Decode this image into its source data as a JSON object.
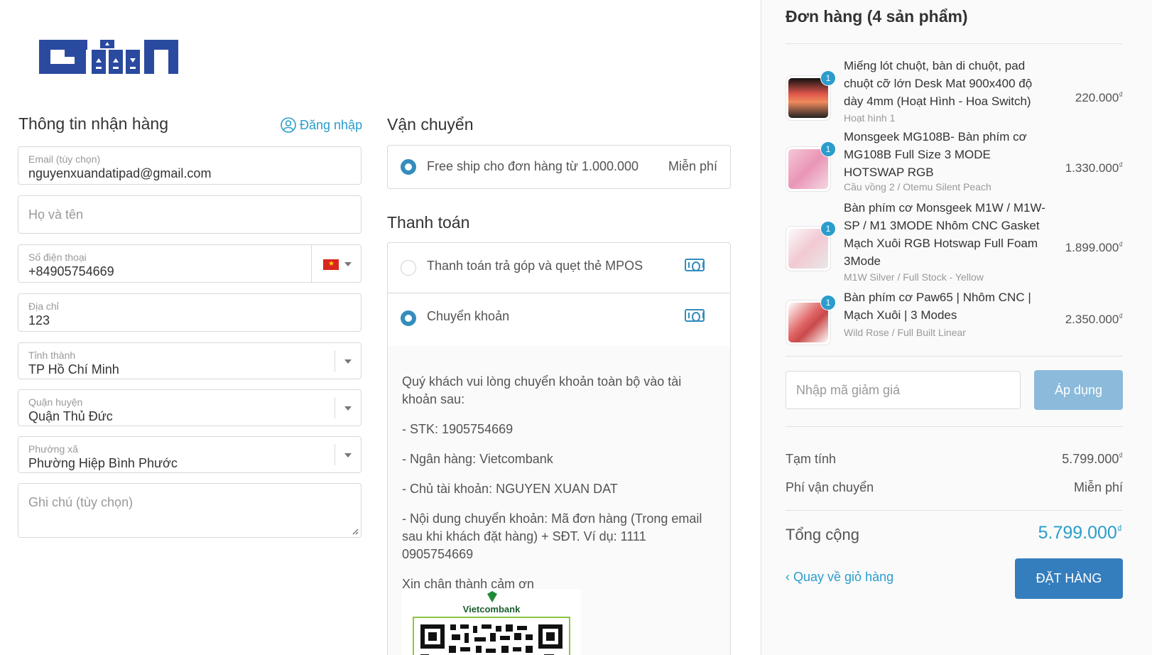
{
  "brand": {
    "logo_icon": "gtn-logo",
    "accent": "#2a9dcc",
    "primary": "#357ebd"
  },
  "shipping_info": {
    "title": "Thông tin nhận hàng",
    "login_label": "Đăng nhập",
    "email": {
      "label": "Email (tùy chọn)",
      "value": "nguyenxuandatipad@gmail.com"
    },
    "name": {
      "placeholder": "Họ và tên"
    },
    "phone": {
      "label": "Số điện thoại",
      "value": "+84905754669"
    },
    "address": {
      "label": "Địa chỉ",
      "value": "123"
    },
    "province": {
      "label": "Tỉnh thành",
      "value": "TP Hồ Chí Minh"
    },
    "district": {
      "label": "Quận huyện",
      "value": "Quận Thủ Đức"
    },
    "ward": {
      "label": "Phường xã",
      "value": "Phường Hiệp Bình Phước"
    },
    "note": {
      "placeholder": "Ghi chú (tùy chọn)"
    }
  },
  "delivery": {
    "title": "Vận chuyển",
    "option": {
      "label": "Free ship cho đơn hàng từ 1.000.000",
      "price": "Miễn phí"
    }
  },
  "payment": {
    "title": "Thanh toán",
    "options": [
      {
        "label": "Thanh toán trả góp và quẹt thẻ MPOS",
        "selected": false
      },
      {
        "label": "Chuyển khoản",
        "selected": true
      }
    ],
    "bank_lines": [
      "Quý khách vui lòng chuyển khoản toàn bộ vào tài khoản sau:",
      "- STK: 1905754669",
      "- Ngân hàng: Vietcombank",
      "- Chủ tài khoản: NGUYEN XUAN DAT",
      "- Nội dung chuyển khoản: Mã đơn hàng (Trong email sau khi khách đặt hàng) + SĐT. Ví dụ: 1111 0905754669",
      "Xin chân thành cảm ơn"
    ],
    "qr_bank": "Vietcombank"
  },
  "order": {
    "title": "Đơn hàng (4 sản phẩm)",
    "currency": "₫",
    "items": [
      {
        "qty": "1",
        "name": "Miếng lót chuột, bàn di chuột, pad chuột cỡ lớn Desk Mat 900x400 độ dày 4mm (Hoạt Hình - Hoa Switch)",
        "variant": "Hoạt hình 1",
        "price": "220.000"
      },
      {
        "qty": "1",
        "name": "Monsgeek MG108B- Bàn phím cơ MG108B Full Size 3 MODE HOTSWAP RGB",
        "variant": "Cầu vồng 2 / Otemu Silent Peach",
        "price": "1.330.000"
      },
      {
        "qty": "1",
        "name": "Bàn phím cơ Monsgeek M1W / M1W-SP / M1 3MODE Nhôm CNC Gasket Mạch Xuôi RGB Hotswap Full Foam 3Mode",
        "variant": "M1W Silver / Full Stock - Yellow",
        "price": "1.899.000"
      },
      {
        "qty": "1",
        "name": "Bàn phím cơ Paw65 | Nhôm CNC | Mạch Xuôi | 3 Modes",
        "variant": "Wild Rose / Full Built Linear",
        "price": "2.350.000"
      }
    ],
    "coupon_placeholder": "Nhập mã giảm giá",
    "apply_label": "Áp dụng",
    "subtotal_label": "Tạm tính",
    "subtotal": "5.799.000",
    "shipping_label": "Phí vận chuyển",
    "shipping": "Miễn phí",
    "total_label": "Tổng cộng",
    "total": "5.799.000",
    "back_label": "Quay về giỏ hàng",
    "place_order_label": "ĐẶT HÀNG"
  }
}
